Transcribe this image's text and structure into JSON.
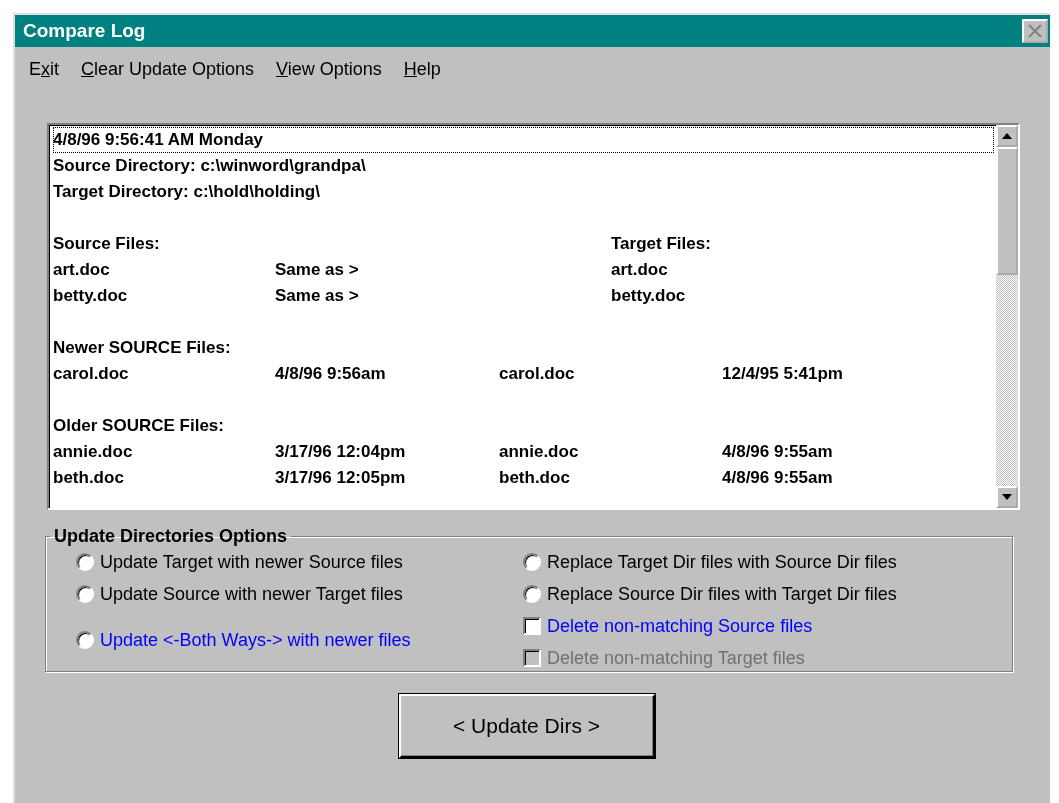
{
  "window": {
    "title": "Compare Log"
  },
  "menu": [
    {
      "before": "E",
      "accelerator": "x",
      "after": "it"
    },
    {
      "accelerator": "C",
      "after": "lear Update Options"
    },
    {
      "accelerator": "V",
      "after": "iew Options"
    },
    {
      "accelerator": "H",
      "after": "elp"
    }
  ],
  "log": [
    {
      "kind": "text",
      "text": "4/8/96 9:56:41 AM Monday",
      "selected": true
    },
    {
      "kind": "text",
      "text": "Source Directory: c:\\winword\\grandpa\\",
      "selected": false
    },
    {
      "kind": "text",
      "text": "Target Directory: c:\\hold\\holding\\",
      "selected": false
    },
    {
      "kind": "blank",
      "selected": false
    },
    {
      "kind": "pair_header",
      "source": "Source Files:",
      "target": "Target Files:",
      "selected": false
    },
    {
      "kind": "same",
      "source": "art.doc",
      "relation": "Same as >",
      "target": "art.doc",
      "selected": false
    },
    {
      "kind": "same",
      "source": "betty.doc",
      "relation": "Same as >",
      "target": "betty.doc",
      "selected": false
    },
    {
      "kind": "blank",
      "selected": false
    },
    {
      "kind": "text",
      "text": "Newer SOURCE Files:",
      "selected": false
    },
    {
      "kind": "dated",
      "source": "carol.doc",
      "source_date": "4/8/96 9:56am",
      "target": "carol.doc",
      "target_date": "12/4/95 5:41pm",
      "selected": false
    },
    {
      "kind": "blank",
      "selected": false
    },
    {
      "kind": "text",
      "text": "Older SOURCE Files:",
      "selected": false
    },
    {
      "kind": "dated",
      "source": "annie.doc",
      "source_date": "3/17/96 12:04pm",
      "target": "annie.doc",
      "target_date": "4/8/96 9:55am",
      "selected": false
    },
    {
      "kind": "dated",
      "source": "beth.doc",
      "source_date": "3/17/96 12:05pm",
      "target": "beth.doc",
      "target_date": "4/8/96 9:55am",
      "selected": false
    }
  ],
  "options_group": {
    "title": "Update Directories Options",
    "left": [
      {
        "kind": "radio",
        "label": "Update Target with newer Source files",
        "selected": false,
        "disabled": false,
        "color": "#000000"
      },
      {
        "kind": "radio",
        "label": "Update Source with newer Target files",
        "selected": false,
        "disabled": false,
        "color": "#000000"
      },
      {
        "kind": "radio",
        "label": "Update <-Both Ways-> with newer files",
        "selected": false,
        "disabled": false,
        "color": "#0000ff"
      }
    ],
    "right": [
      {
        "kind": "radio",
        "label": "Replace Target Dir files with Source Dir files",
        "selected": false,
        "disabled": false,
        "color": "#000000"
      },
      {
        "kind": "radio",
        "label": "Replace Source Dir files with Target Dir files",
        "selected": false,
        "disabled": false,
        "color": "#000000"
      },
      {
        "kind": "checkbox",
        "label": "Delete non-matching Source files",
        "checked": false,
        "disabled": false,
        "color": "#0000ff"
      },
      {
        "kind": "checkbox",
        "label": "Delete non-matching Target files",
        "checked": false,
        "disabled": true
      }
    ]
  },
  "action_button": {
    "label": "< Update Dirs >"
  }
}
